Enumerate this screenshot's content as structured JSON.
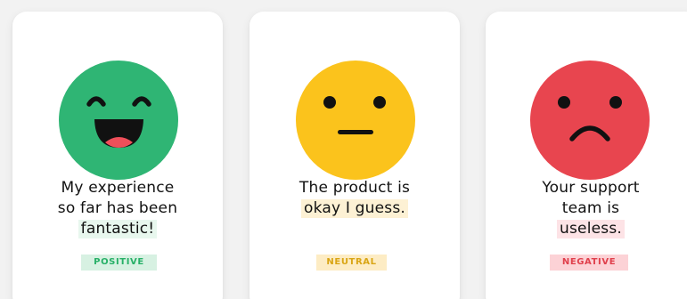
{
  "cards": [
    {
      "sentiment": "positive",
      "face_color": "#2fb574",
      "icon": "happy-face-icon",
      "quote_lines": [
        "My experience",
        "so far has been"
      ],
      "highlight": "fantastic!",
      "badge": "POSITIVE"
    },
    {
      "sentiment": "neutral",
      "face_color": "#fbc31c",
      "icon": "neutral-face-icon",
      "quote_lines": [
        "The product is"
      ],
      "highlight": "okay I guess.",
      "badge": "NEUTRAL"
    },
    {
      "sentiment": "negative",
      "face_color": "#e8454f",
      "icon": "sad-face-icon",
      "quote_lines": [
        "Your support",
        "team is"
      ],
      "highlight": "useless.",
      "badge": "NEGATIVE"
    }
  ]
}
